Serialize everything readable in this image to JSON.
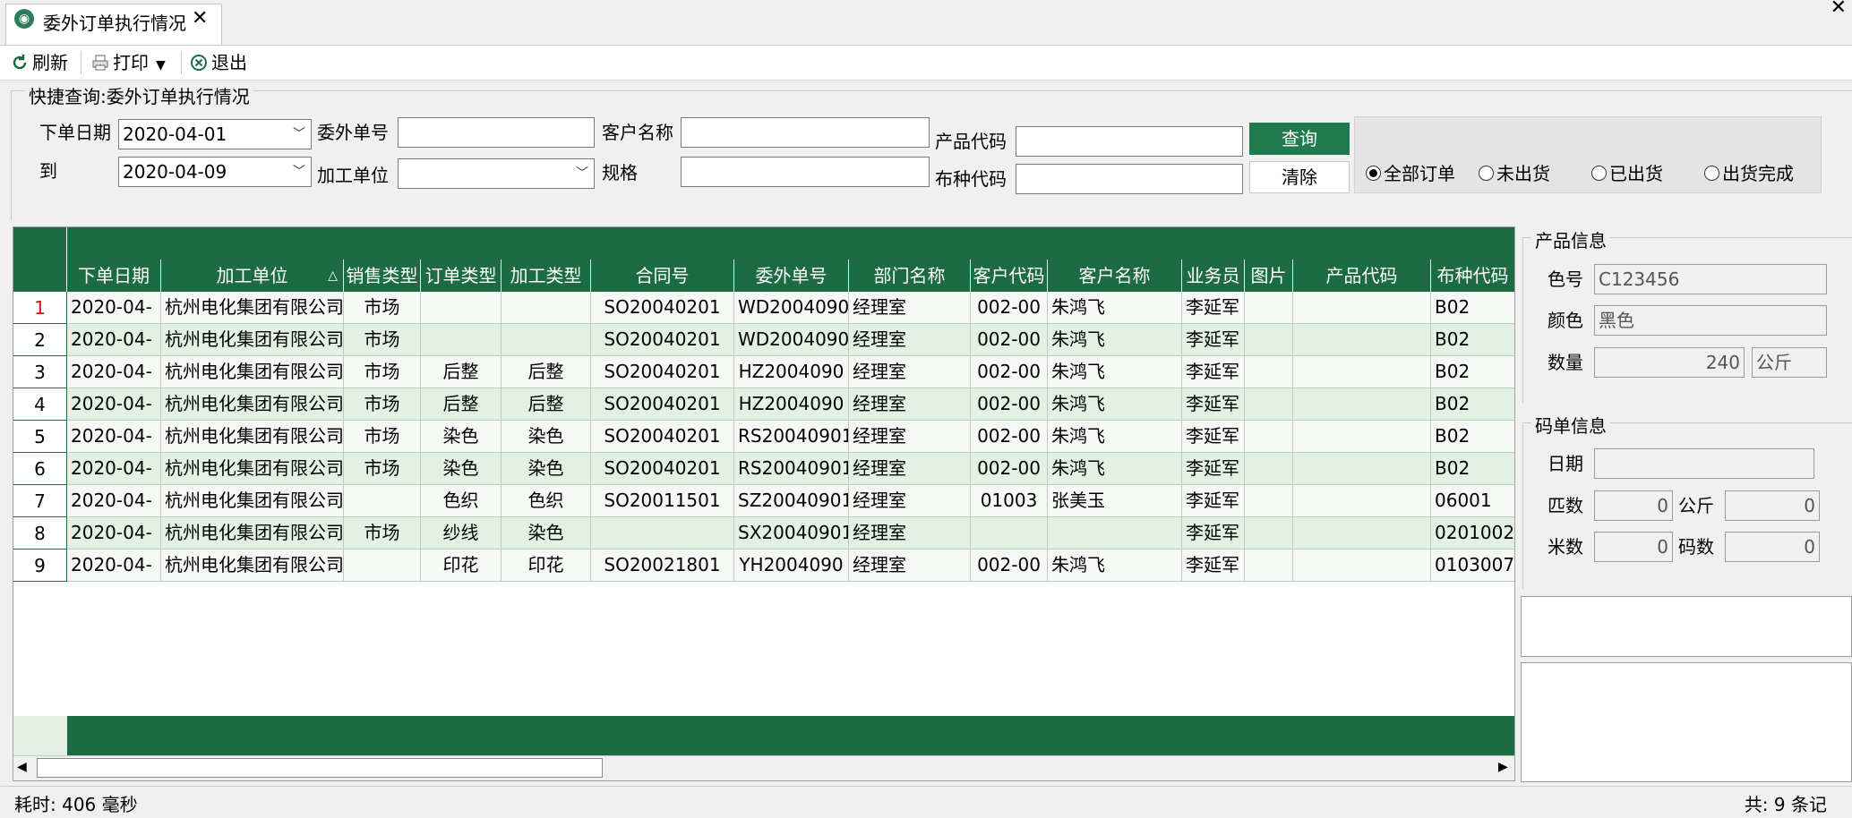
{
  "tab": {
    "title": "委外订单执行情况",
    "close": "✕"
  },
  "window": {
    "close": "✕"
  },
  "toolbar": {
    "refresh": "刷新",
    "print": "打印",
    "exit": "退出"
  },
  "query": {
    "group_title": "快捷查询:委外订单执行情况",
    "order_date_label": "下单日期",
    "order_date_from": "2020-04-01",
    "to_label": "到",
    "order_date_to": "2020-04-09",
    "outsource_no_label": "委外单号",
    "outsource_no": "",
    "processor_label": "加工单位",
    "processor": "",
    "customer_name_label": "客户名称",
    "customer_name": "",
    "spec_label": "规格",
    "spec": "",
    "product_code_label": "产品代码",
    "product_code": "",
    "fabric_code_label": "布种代码",
    "fabric_code": "",
    "query_btn": "查询",
    "clear_btn": "清除",
    "radios": [
      {
        "label": "全部订单",
        "checked": true
      },
      {
        "label": "未出货",
        "checked": false
      },
      {
        "label": "已出货",
        "checked": false
      },
      {
        "label": "出货完成",
        "checked": false
      }
    ]
  },
  "grid": {
    "columns": [
      "下单日期",
      "加工单位",
      "销售类型",
      "订单类型",
      "加工类型",
      "合同号",
      "委外单号",
      "部门名称",
      "客户代码",
      "客户名称",
      "业务员",
      "图片",
      "产品代码",
      "布种代码"
    ],
    "sort_indicator": "△",
    "rows": [
      {
        "no": "1",
        "cells": [
          "2020-04-",
          "杭州电化集团有限公司",
          "市场",
          "",
          "",
          "SO20040201",
          "WD2004090",
          "经理室",
          "002-00",
          "朱鸿飞",
          "李延军",
          "",
          "",
          "B02"
        ]
      },
      {
        "no": "2",
        "cells": [
          "2020-04-",
          "杭州电化集团有限公司",
          "市场",
          "",
          "",
          "SO20040201",
          "WD2004090",
          "经理室",
          "002-00",
          "朱鸿飞",
          "李延军",
          "",
          "",
          "B02"
        ]
      },
      {
        "no": "3",
        "cells": [
          "2020-04-",
          "杭州电化集团有限公司",
          "市场",
          "后整",
          "后整",
          "SO20040201",
          "HZ2004090",
          "经理室",
          "002-00",
          "朱鸿飞",
          "李延军",
          "",
          "",
          "B02"
        ]
      },
      {
        "no": "4",
        "cells": [
          "2020-04-",
          "杭州电化集团有限公司",
          "市场",
          "后整",
          "后整",
          "SO20040201",
          "HZ2004090",
          "经理室",
          "002-00",
          "朱鸿飞",
          "李延军",
          "",
          "",
          "B02"
        ]
      },
      {
        "no": "5",
        "cells": [
          "2020-04-",
          "杭州电化集团有限公司",
          "市场",
          "染色",
          "染色",
          "SO20040201",
          "RS20040901",
          "经理室",
          "002-00",
          "朱鸿飞",
          "李延军",
          "",
          "",
          "B02"
        ]
      },
      {
        "no": "6",
        "cells": [
          "2020-04-",
          "杭州电化集团有限公司",
          "市场",
          "染色",
          "染色",
          "SO20040201",
          "RS20040901",
          "经理室",
          "002-00",
          "朱鸿飞",
          "李延军",
          "",
          "",
          "B02"
        ]
      },
      {
        "no": "7",
        "cells": [
          "2020-04-",
          "杭州电化集团有限公司",
          "",
          "色织",
          "色织",
          "SO20011501",
          "SZ20040901",
          "经理室",
          "01003",
          "张美玉",
          "李延军",
          "",
          "",
          "06001"
        ]
      },
      {
        "no": "8",
        "cells": [
          "2020-04-",
          "杭州电化集团有限公司",
          "市场",
          "纱线",
          "染色",
          "",
          "SX20040901",
          "经理室",
          "",
          "",
          "李延军",
          "",
          "",
          "0201002"
        ]
      },
      {
        "no": "9",
        "cells": [
          "2020-04-",
          "杭州电化集团有限公司",
          "",
          "印花",
          "印花",
          "SO20021801",
          "YH2004090",
          "经理室",
          "002-00",
          "朱鸿飞",
          "李延军",
          "",
          "",
          "0103007"
        ]
      }
    ]
  },
  "product_info": {
    "title": "产品信息",
    "color_no_label": "色号",
    "color_no": "C123456",
    "color_label": "颜色",
    "color": "黑色",
    "qty_label": "数量",
    "qty": "240",
    "unit": "公斤"
  },
  "code_info": {
    "title": "码单信息",
    "date_label": "日期",
    "date": "",
    "pieces_label": "匹数",
    "pieces": "0",
    "kg_label": "公斤",
    "kg": "0",
    "meters_label": "米数",
    "meters": "0",
    "codes_label": "码数",
    "codes": "0"
  },
  "status": {
    "elapsed": "耗时: 406 毫秒",
    "count": "共: 9 条记"
  },
  "colors": {
    "header_green": "#1d6b43",
    "row_even": "#e3f1e4",
    "row_odd": "#f5f8f5",
    "row_num_active": "#d01010"
  }
}
